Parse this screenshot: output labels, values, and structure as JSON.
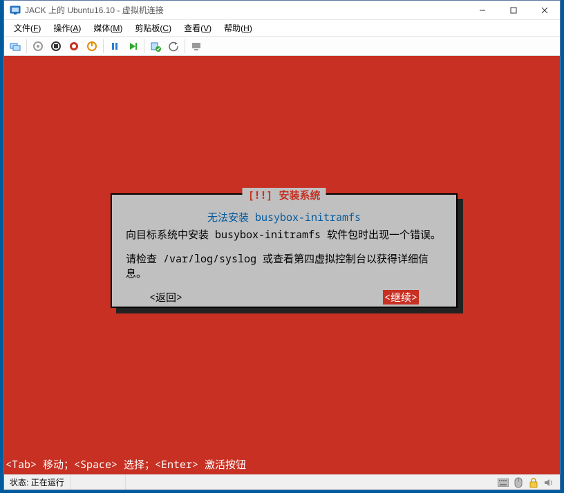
{
  "window": {
    "title": "JACK 上的 Ubuntu16.10 - 虚拟机连接"
  },
  "menu": {
    "file": {
      "label": "文件",
      "hotkey": "F"
    },
    "action": {
      "label": "操作",
      "hotkey": "A"
    },
    "media": {
      "label": "媒体",
      "hotkey": "M"
    },
    "clip": {
      "label": "剪贴板",
      "hotkey": "C"
    },
    "view": {
      "label": "查看",
      "hotkey": "V"
    },
    "help": {
      "label": "帮助",
      "hotkey": "H"
    }
  },
  "dialog": {
    "frame_title": "[!!] 安装系统",
    "subtitle": "无法安装 busybox-initramfs",
    "line1": "向目标系统中安装 busybox-initramfs 软件包时出现一个错误。",
    "line2": "请检查 /var/log/syslog 或查看第四虚拟控制台以获得详细信息。",
    "back_label": "<返回>",
    "continue_label": "<继续>"
  },
  "hint": "<Tab> 移动；<Space> 选择；<Enter> 激活按钮",
  "status": {
    "label": "状态:",
    "value": "正在运行"
  }
}
